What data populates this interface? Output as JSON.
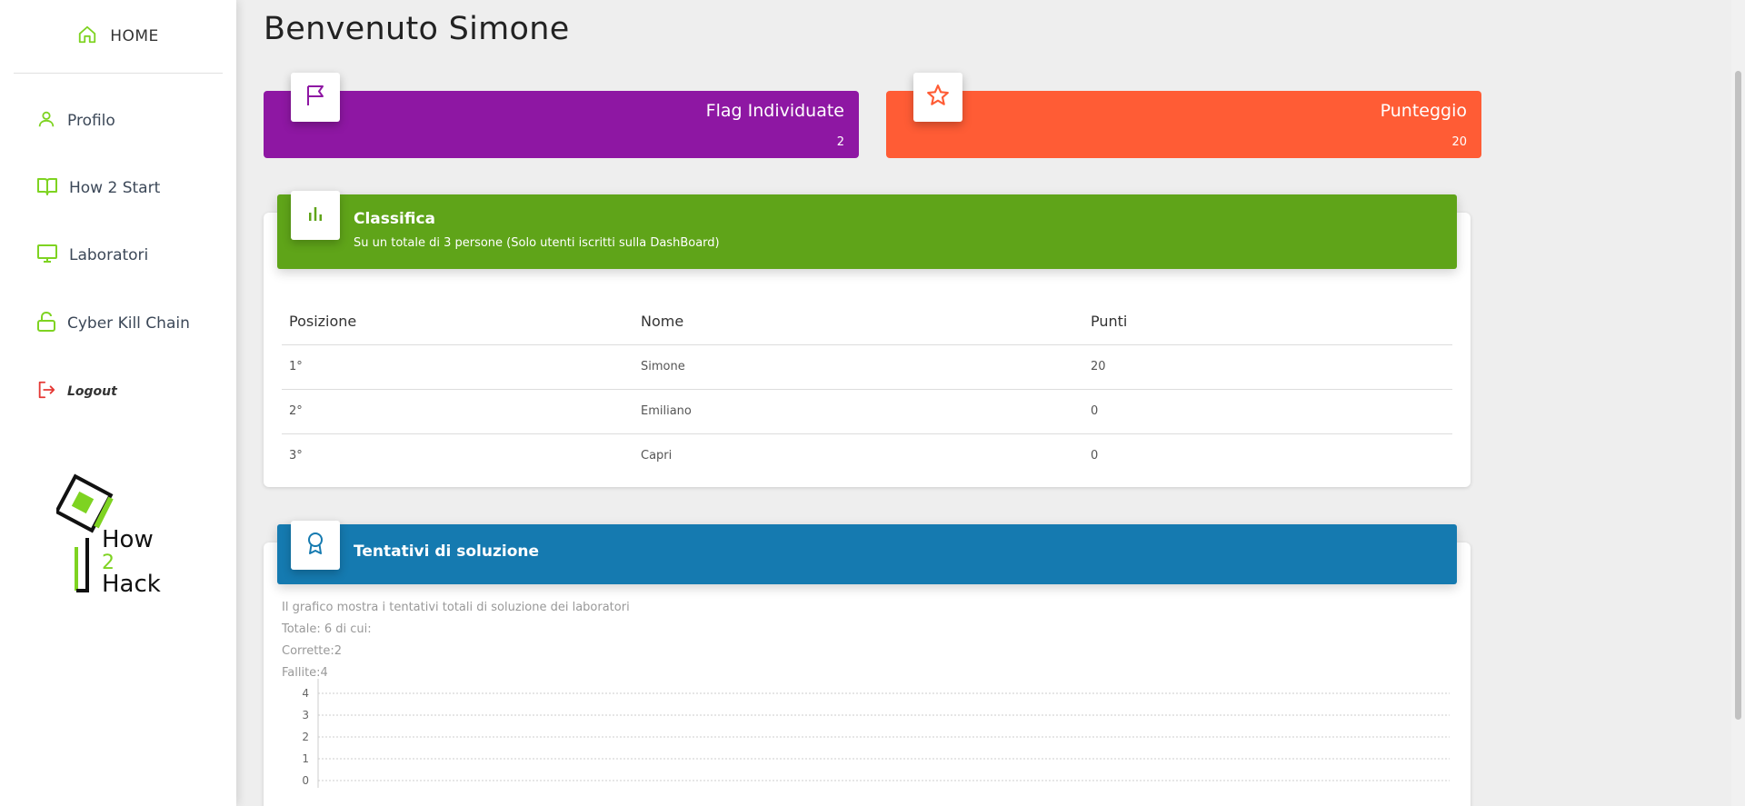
{
  "sidebar": {
    "home_label": "HOME",
    "items": [
      {
        "label": "Profilo",
        "icon": "user-icon"
      },
      {
        "label": "How 2 Start",
        "icon": "book-icon"
      },
      {
        "label": "Laboratori",
        "icon": "monitor-icon"
      },
      {
        "label": "Cyber Kill Chain",
        "icon": "lock-open-icon"
      }
    ],
    "logout_label": "Logout",
    "logo": {
      "line1": "How",
      "line2": "2",
      "line3": "Hack"
    }
  },
  "main": {
    "title": "Benvenuto Simone",
    "stats": [
      {
        "title": "Flag Individuate",
        "value": "2",
        "color": "#8e17a3",
        "icon": "flag-icon"
      },
      {
        "title": "Punteggio",
        "value": "20",
        "color": "#ff5c35",
        "icon": "star-icon"
      }
    ],
    "leaderboard": {
      "title": "Classifica",
      "subtitle": "Su un totale di 3 persone (Solo utenti iscritti sulla DashBoard)",
      "color": "#5fa419",
      "columns": [
        "Posizione",
        "Nome",
        "Punti"
      ],
      "rows": [
        [
          "1°",
          "Simone",
          "20"
        ],
        [
          "2°",
          "Emiliano",
          "0"
        ],
        [
          "3°",
          "Capri",
          "0"
        ]
      ]
    },
    "attempts": {
      "title": "Tentativi di soluzione",
      "color": "#157ab0",
      "description": "Il grafico mostra i tentativi totali di soluzione dei laboratori",
      "total": "Totale: 6 di cui:",
      "correct": "Corrette:2",
      "failed": "Fallite:4"
    }
  },
  "chart_data": {
    "type": "line",
    "y_ticks": [
      "4",
      "3",
      "2",
      "1",
      "0"
    ],
    "ylim": [
      0,
      4
    ],
    "grid": true
  }
}
